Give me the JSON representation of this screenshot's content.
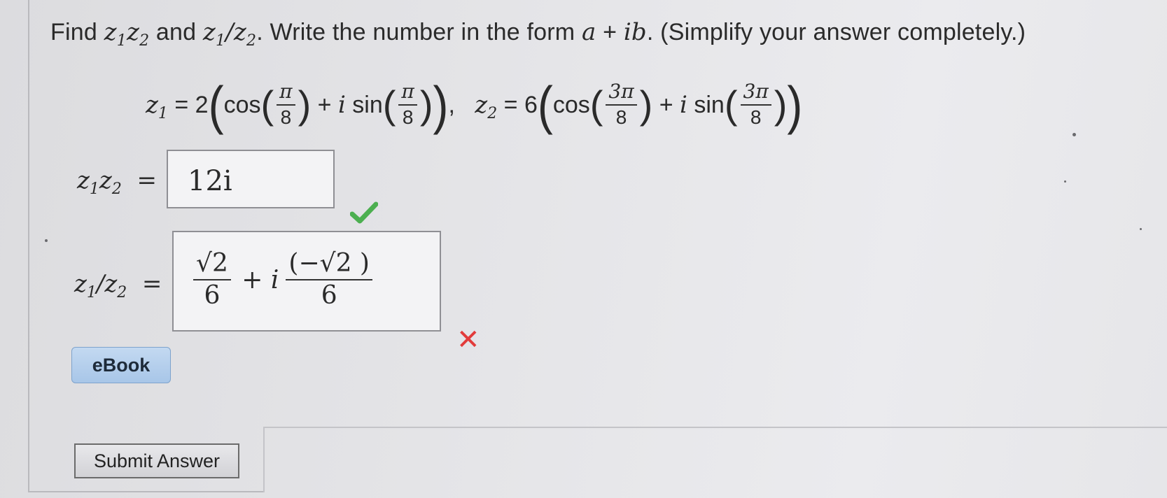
{
  "question": {
    "find": "Find",
    "and": "and",
    "instruction": ". Write the number in the form",
    "form_a": "a",
    "form_plus": "+",
    "form_ib": "ib",
    "simplify": ". (Simplify your answer completely.)"
  },
  "given": {
    "z1_coef": "2",
    "z1_angle_num": "π",
    "z1_angle_den": "8",
    "z2_coef": "6",
    "z2_angle_num": "3π",
    "z2_angle_den": "8"
  },
  "answers": {
    "product_value": "12i",
    "product_status": "correct",
    "quotient_real_num": "√2",
    "quotient_real_den": "6",
    "quotient_imag_num": "(−√2 )",
    "quotient_imag_den": "6",
    "quotient_status": "incorrect"
  },
  "buttons": {
    "ebook": "eBook",
    "submit": "Submit Answer"
  },
  "colors": {
    "correct": "#4caf50",
    "incorrect": "#e23b3b",
    "ebook_bg": "#b3cfee"
  }
}
